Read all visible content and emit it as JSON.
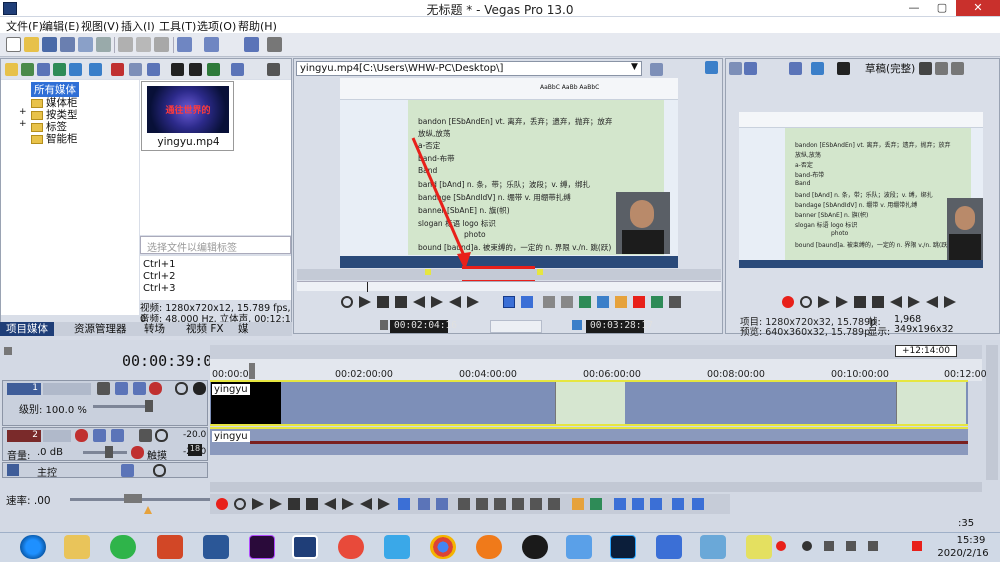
{
  "window": {
    "title": "无标题 * - Vegas Pro 13.0",
    "minimize": "—",
    "maximize": "▢",
    "close": "✕"
  },
  "menu": [
    "文件(F)",
    "编辑(E)",
    "视图(V)",
    "插入(I)",
    "工具(T)",
    "选项(O)",
    "帮助(H)"
  ],
  "media_panel": {
    "tree": [
      "所有媒体",
      "媒体柜",
      "按类型",
      "标签",
      "智能柜"
    ],
    "thumbnail_label": "yingyu.mp4",
    "thumbnail_text": "通往世界的",
    "search_placeholder": "选择文件以编辑标签",
    "shortcuts": [
      "Ctrl+1",
      "Ctrl+2",
      "Ctrl+3"
    ],
    "info_video": "视频: 1280x720x12, 15.789 fps, 0",
    "info_audio": "音频: 48,000 Hz, 立体声, 00:12:1",
    "tabs": [
      "项目媒体",
      "资源管理器",
      "转场",
      "视频 FX",
      "媒"
    ]
  },
  "trimmer": {
    "file": "yingyu.mp4",
    "path": "[C:\\Users\\WHW-PC\\Desktop\\]",
    "time_in": "00:02:04:16",
    "time_out": "00:03:28:17",
    "doc_lines": [
      "bandon [ESbAndEn]  vt. 离弃，丢弃；遗弃，抛弃；放弃",
      "放纵,放荡",
      "a-否定",
      "band-布带",
      "Band",
      "band [bAnd]   n. 条，带；乐队；波段；v. 缚，绑扎",
      "bandage [SbAndIdV]   n. 绷带 v. 用绷带扎缚",
      "banner  [SbAnE]   n. 旗(帜)",
      "slogan  标语  logo  标识",
      "photo",
      "bound  [baund]a. 被束缚的，一定的   n. 界限 v./n. 跳(跃)",
      "boundary [SbaundEri]  n. 分界线，边界"
    ]
  },
  "preview": {
    "quality": "草稿(完整)",
    "project": "项目: 1280x720x32, 15.789p",
    "preview_res": "预览: 640x360x32, 15.789p",
    "frame_label": "帧:",
    "frame_value": "1,968",
    "display_label": "显示:",
    "display_value": "349x196x32"
  },
  "timeline": {
    "timecode": "00:00:39:00",
    "loop_end": "+12:14:00",
    "ruler": [
      "00:00:00",
      "00:02:00:00",
      "00:04:00:00",
      "00:06:00:00",
      "00:08:00:00",
      "00:10:00:00",
      "00:12:00"
    ],
    "video_track": {
      "number": "1",
      "level": "级别: 100.0 %",
      "clip_label": "yingyu"
    },
    "audio_track": {
      "number": "2",
      "volume": "音量:",
      "volume_value": ".0 dB",
      "pan": "触摸",
      "db_top": "-20.0",
      "db_bottom": "-20.0",
      "clip_label": "yingyu",
      "meter": "18"
    },
    "master": "主控",
    "rate": "速率: .00",
    "end_time": ":35"
  },
  "taskbar": {
    "time": "15:39",
    "date": "2020/2/16"
  },
  "colors": {
    "accent_red": "#e8201a",
    "clip_yellow": "#e6e640",
    "selection_blue": "#7d8fb8"
  }
}
